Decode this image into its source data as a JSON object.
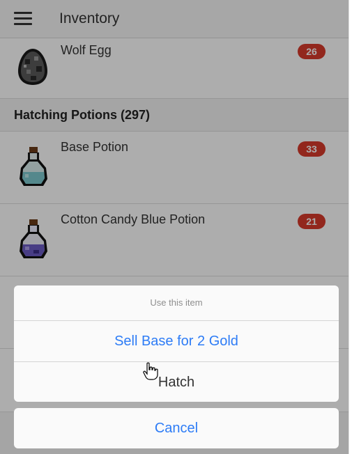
{
  "header": {
    "title": "Inventory",
    "menu_icon": "hamburger-menu-icon"
  },
  "items": [
    {
      "name": "Wolf Egg",
      "count": "26",
      "icon": "wolf-egg-icon"
    }
  ],
  "section": {
    "label": "Hatching Potions (297)"
  },
  "potions": [
    {
      "name": "Base Potion",
      "count": "33",
      "icon": "base-potion-icon"
    },
    {
      "name": "Cotton Candy Blue Potion",
      "count": "21",
      "icon": "cotton-candy-blue-potion-icon"
    }
  ],
  "action_sheet": {
    "title": "Use this item",
    "sell_label": "Sell Base for 2 Gold",
    "hatch_label": "Hatch",
    "cancel_label": "Cancel"
  },
  "colors": {
    "badge": "#d83a2b",
    "action_blue": "#2d7cf6"
  }
}
